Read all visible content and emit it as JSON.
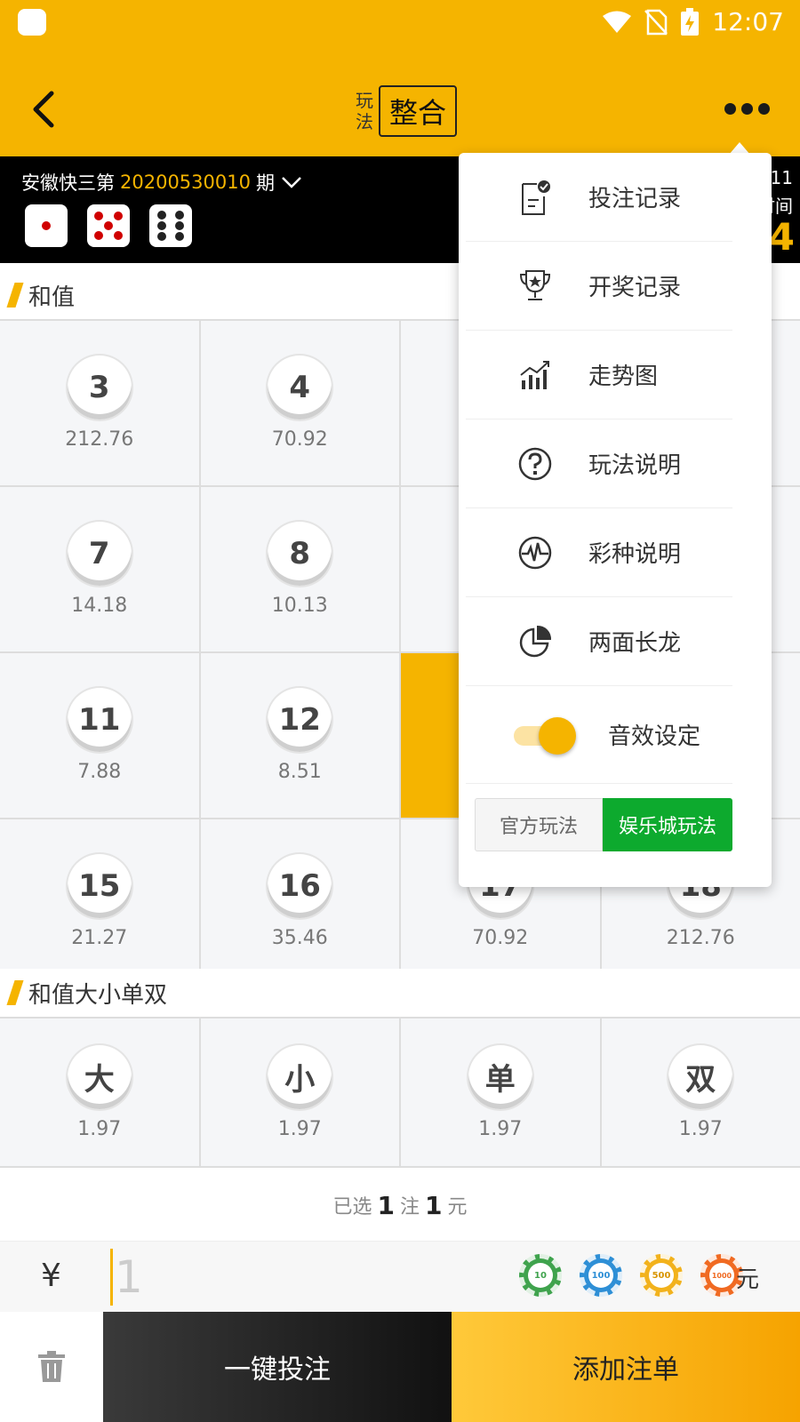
{
  "status_bar": {
    "time": "12:07"
  },
  "nav": {
    "title_small_1": "玩",
    "title_small_2": "法",
    "title_box": "整合"
  },
  "draw": {
    "lottery_name": "安徽快三第",
    "period_number": "20200530010",
    "period_suffix": "期",
    "right_top": "11",
    "right_mid": "时间",
    "right_big": "4",
    "dice": [
      1,
      5,
      6
    ]
  },
  "sections": {
    "sum": "和值",
    "sum_bsoe": "和值大小单双"
  },
  "sum_grid": [
    {
      "num": "3",
      "odds": "212.76"
    },
    {
      "num": "4",
      "odds": "70.92"
    },
    {
      "num": "",
      "odds": ""
    },
    {
      "num": "",
      "odds": ""
    },
    {
      "num": "7",
      "odds": "14.18"
    },
    {
      "num": "8",
      "odds": "10.13"
    },
    {
      "num": "",
      "odds": ""
    },
    {
      "num": "",
      "odds": ""
    },
    {
      "num": "11",
      "odds": "7.88"
    },
    {
      "num": "12",
      "odds": "8.51"
    },
    {
      "num": "",
      "odds": ""
    },
    {
      "num": "",
      "odds": ""
    },
    {
      "num": "15",
      "odds": "21.27"
    },
    {
      "num": "16",
      "odds": "35.46"
    },
    {
      "num": "17",
      "odds": "70.92"
    },
    {
      "num": "18",
      "odds": "212.76"
    }
  ],
  "bsoe_grid": [
    {
      "num": "大",
      "odds": "1.97"
    },
    {
      "num": "小",
      "odds": "1.97"
    },
    {
      "num": "单",
      "odds": "1.97"
    },
    {
      "num": "双",
      "odds": "1.97"
    }
  ],
  "summary": {
    "prefix": "已选",
    "count": "1",
    "mid": "注",
    "amount": "1",
    "suffix": "元"
  },
  "amount": {
    "currency": "¥",
    "value": "1",
    "unit": "元",
    "chips": [
      "10",
      "100",
      "500",
      "1000"
    ]
  },
  "actions": {
    "quick_bet": "一键投注",
    "add_order": "添加注单"
  },
  "menu": {
    "items": [
      {
        "label": "投注记录",
        "icon": "clipboard-check-icon"
      },
      {
        "label": "开奖记录",
        "icon": "trophy-icon"
      },
      {
        "label": "走势图",
        "icon": "trend-chart-icon"
      },
      {
        "label": "玩法说明",
        "icon": "question-circle-icon"
      },
      {
        "label": "彩种说明",
        "icon": "pulse-circle-icon"
      },
      {
        "label": "两面长龙",
        "icon": "pie-chart-icon"
      }
    ],
    "sound_label": "音效设定",
    "mode_official": "官方玩法",
    "mode_casino": "娱乐城玩法"
  },
  "colors": {
    "brand": "#F5B400",
    "green": "#0DAA2E",
    "dark": "#000000"
  }
}
